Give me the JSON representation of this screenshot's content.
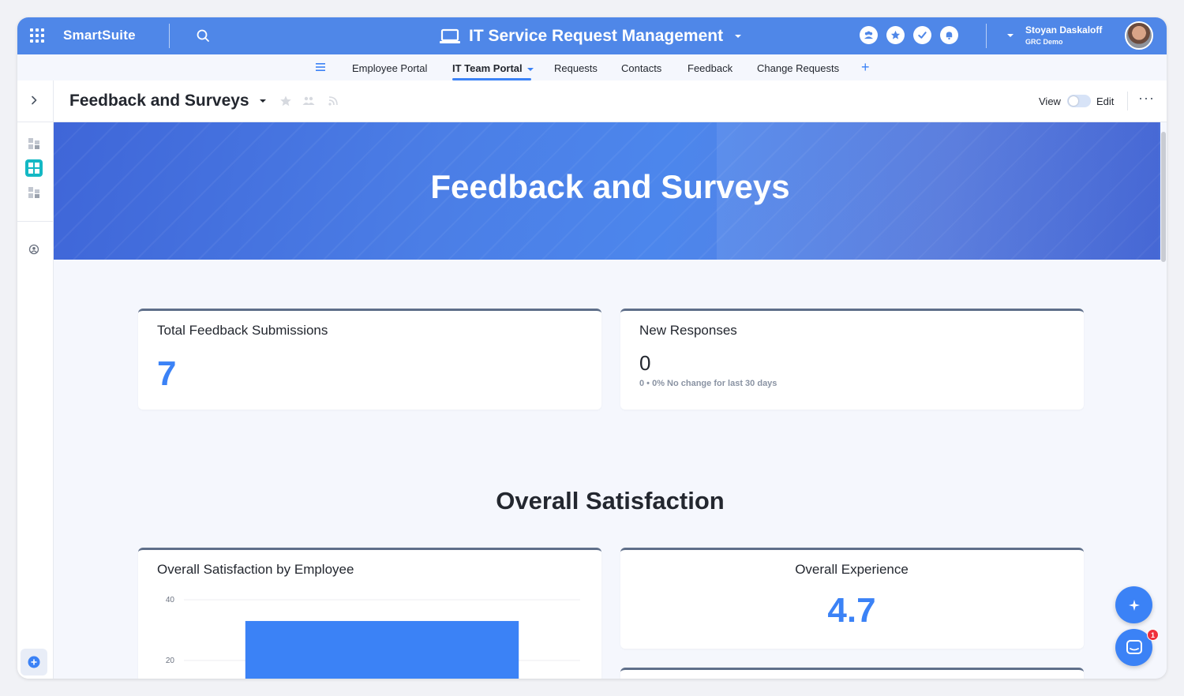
{
  "topbar": {
    "brand": "SmartSuite",
    "app_title": "IT Service Request Management",
    "user_name": "Stoyan Daskaloff",
    "user_org": "GRC Demo",
    "accent": "#4f87e8"
  },
  "nav": {
    "tabs": [
      {
        "label": "Employee Portal"
      },
      {
        "label": "IT Team Portal"
      },
      {
        "label": "Requests"
      },
      {
        "label": "Contacts"
      },
      {
        "label": "Feedback"
      },
      {
        "label": "Change Requests"
      }
    ],
    "add": "+"
  },
  "page": {
    "title": "Feedback and Surveys",
    "view_label": "View",
    "edit_label": "Edit",
    "more": "···"
  },
  "banner": {
    "title": "Feedback and Surveys"
  },
  "metrics": {
    "total_title": "Total Feedback Submissions",
    "total_value": "7",
    "new_title": "New Responses",
    "new_value": "0",
    "new_sub": "0 • 0% No change for last 30 days"
  },
  "section": {
    "title": "Overall Satisfaction"
  },
  "experience": {
    "title": "Overall Experience",
    "value": "4.7"
  },
  "chart_card": {
    "title": "Overall Satisfaction by Employee"
  },
  "chart_data": {
    "type": "bar",
    "title": "Overall Satisfaction by Employee",
    "categories": [
      ""
    ],
    "values": [
      33
    ],
    "ylim": [
      0,
      40
    ],
    "yticks": [
      20,
      40
    ],
    "grid": true,
    "bar_color": "#3b82f6"
  },
  "chat": {
    "badge": "1"
  }
}
